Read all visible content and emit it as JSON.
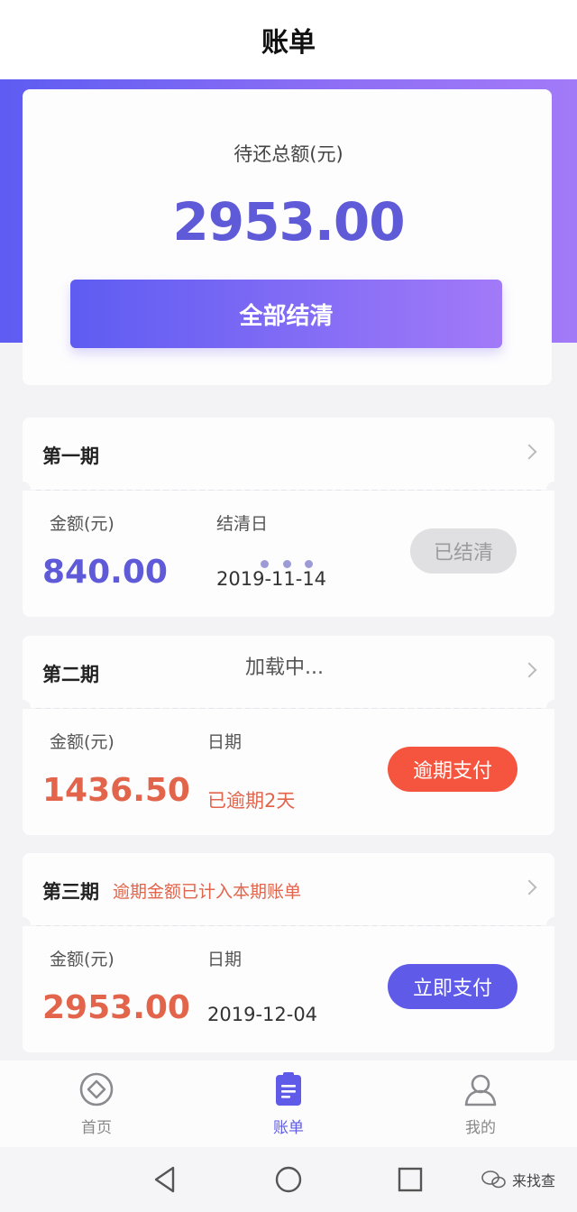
{
  "header": {
    "title": "账单"
  },
  "summary": {
    "label": "待还总额(元)",
    "amount": "2953.00",
    "settle_button": "全部结清"
  },
  "periods": [
    {
      "title": "第一期",
      "note": "",
      "amount_label": "金额(元)",
      "amount": "840.00",
      "date_label": "结清日",
      "date_value": "2019-11-14",
      "action": "已结清"
    },
    {
      "title": "第二期",
      "note": "",
      "amount_label": "金额(元)",
      "amount": "1436.50",
      "date_label": "日期",
      "date_value": "已逾期2天",
      "action": "逾期支付"
    },
    {
      "title": "第三期",
      "note": "逾期金额已计入本期账单",
      "amount_label": "金额(元)",
      "amount": "2953.00",
      "date_label": "日期",
      "date_value": "2019-12-04",
      "action": "立即支付"
    }
  ],
  "loading": {
    "text": "加载中..."
  },
  "tabs": [
    {
      "label": "首页",
      "icon": "home-diamond-icon",
      "active": false
    },
    {
      "label": "账单",
      "icon": "bill-list-icon",
      "active": true
    },
    {
      "label": "我的",
      "icon": "user-profile-icon",
      "active": false
    }
  ],
  "system_nav": {
    "back": "back-triangle-icon",
    "home": "home-circle-icon",
    "recent": "recent-square-icon"
  },
  "watermark": {
    "text": "来找查"
  },
  "colors": {
    "accent": "#5f5ae8",
    "overdue": "#f5553f",
    "text_red": "#e2644b",
    "gradient_start": "#5e5cf2",
    "gradient_end": "#a27af8"
  }
}
